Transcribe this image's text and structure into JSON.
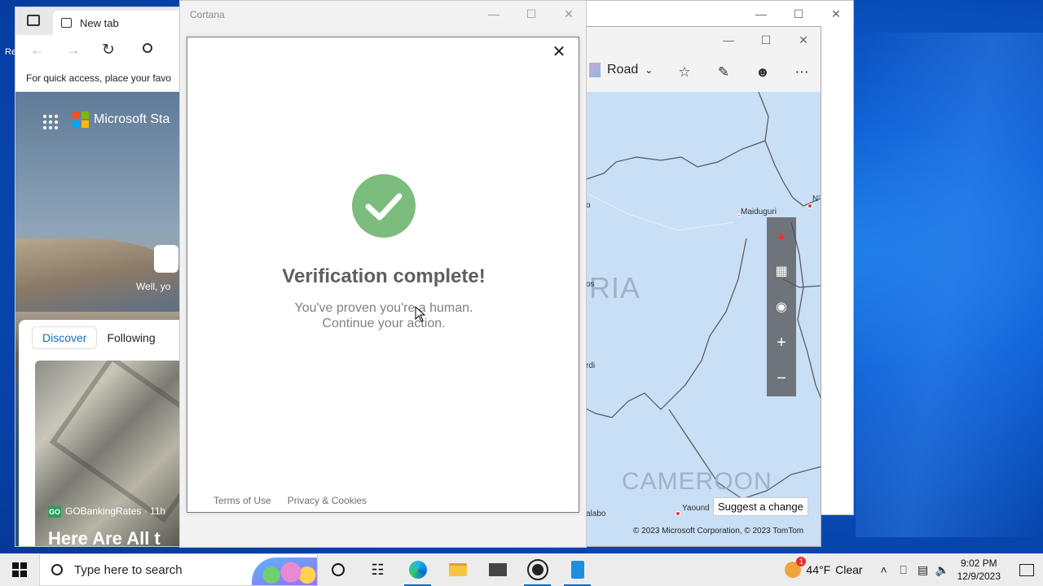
{
  "desktop": {
    "edge_label": "Re"
  },
  "edge": {
    "tab_title": "New tab",
    "favorites_bar": "For quick access, place your favo",
    "brand": "Microsoft Sta",
    "hero_caption": "Well, yo",
    "feed_tabs": [
      "Discover",
      "Following"
    ],
    "news_source": "GOBankingRates · 11h",
    "news_title": "Here Are All t"
  },
  "maps": {
    "road_label": "Road",
    "labels": {
      "maiduguri": "Maiduguri",
      "ria": "RIA",
      "os": "os",
      "rdi": "rdi",
      "o": "o",
      "n": "N'",
      "cameroon": "CAMEROON",
      "yaounde": "Yaound",
      "malabo": "alabo"
    },
    "suggest_change": "Suggest a change",
    "copyright": "© 2023 Microsoft Corporation, © 2023 TomTom"
  },
  "cortana": {
    "window_title": "Cortana",
    "verify_title": "Verification complete!",
    "verify_line1": "You've proven you're a human.",
    "verify_line2": "Continue your action.",
    "terms": "Terms of Use",
    "privacy": "Privacy & Cookies"
  },
  "taskbar": {
    "search_placeholder": "Type here to search",
    "weather_temp": "44°F",
    "weather_cond": "Clear",
    "weather_badge": "1",
    "time": "9:02 PM",
    "date": "12/9/2023"
  },
  "colors": {
    "accent": "#0f6cbd",
    "check_green": "#7cbc7c",
    "map_water": "#c8dff5",
    "desktop_blue": "#0a56c9"
  }
}
